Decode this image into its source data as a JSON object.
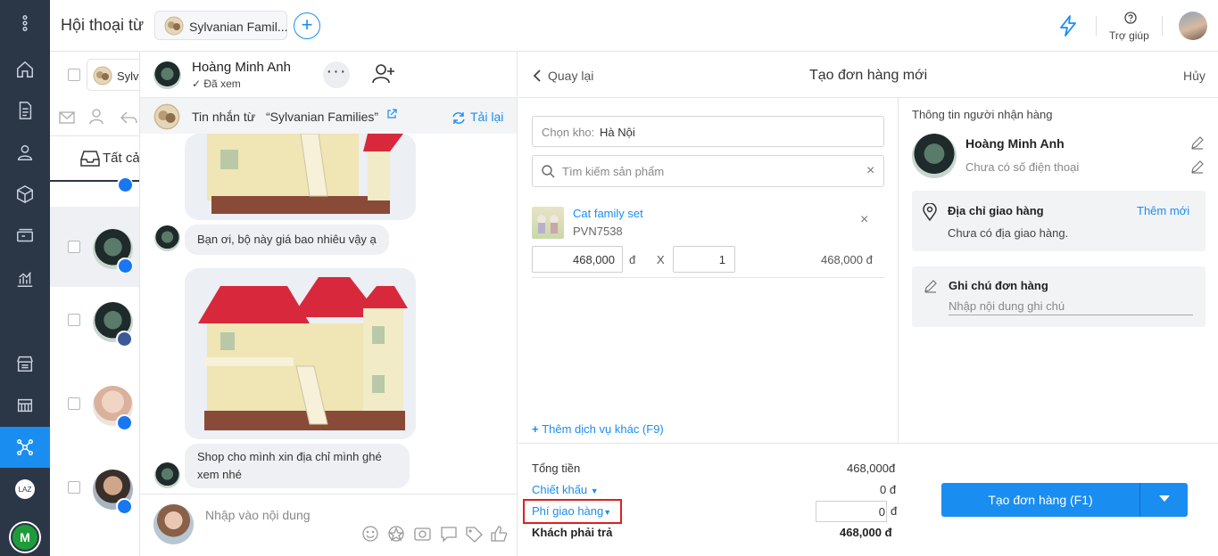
{
  "header": {
    "title": "Hội thoại từ",
    "page_chip": "Sylvanian Famil...",
    "help_label": "Trợ giúp"
  },
  "conv_list": {
    "page_chip_short": "Sylv",
    "tab_all": "Tất cả"
  },
  "chat": {
    "name": "Hoàng Minh Anh",
    "seen": "Đã xem",
    "source_prefix": "Tin nhắn từ",
    "source_page": "“Sylvanian Families”",
    "reload": "Tải lại",
    "msg1": "Bạn ơi, bộ này giá bao nhiêu vậy ạ",
    "msg2_l1": "Shop cho mình xin địa chỉ mình ghé",
    "msg2_l2": "xem nhé",
    "input_placeholder": "Nhập vào nội dung"
  },
  "order": {
    "back": "Quay lại",
    "title": "Tạo đơn hàng mới",
    "cancel": "Hủy",
    "warehouse_label": "Chọn kho:",
    "warehouse_value": "Hà Nội",
    "search_placeholder": "Tìm kiếm sản phẩm",
    "product": {
      "name": "Cat family set",
      "sku": "PVN7538",
      "price": "468,000",
      "currency": "đ",
      "times": "X",
      "qty": "1",
      "total": "468,000 đ"
    },
    "add_service": "Thêm dịch vụ khác (F9)",
    "summary": {
      "total_label": "Tổng tiền",
      "total_value": "468,000đ",
      "discount_label": "Chiết khấu",
      "discount_value": "0 đ",
      "shipping_label": "Phí giao hàng",
      "shipping_value": "0",
      "shipping_currency": "đ",
      "pay_label": "Khách phải trả",
      "pay_value": "468,000 đ"
    },
    "create_button": "Tạo đơn hàng (F1)"
  },
  "recipient": {
    "section_title": "Thông tin người nhận hàng",
    "name": "Hoàng Minh Anh",
    "phone_placeholder": "Chưa có số điện thoại",
    "address_title": "Địa chỉ giao hàng",
    "address_add": "Thêm mới",
    "address_empty": "Chưa có địa giao hàng.",
    "note_title": "Ghi chú đơn hàng",
    "note_placeholder": "Nhập nội dung ghi chú"
  },
  "colors": {
    "accent": "#1a8df0",
    "nav_bg": "#2b3647",
    "highlight_box": "#e01e1e",
    "facebook": "#1877f2"
  },
  "icons": [
    "home-icon",
    "document-icon",
    "user-icon",
    "box-icon",
    "cash-icon",
    "chart-icon",
    "store-icon",
    "shelf-icon",
    "network-icon",
    "lightning-icon",
    "help-icon"
  ]
}
